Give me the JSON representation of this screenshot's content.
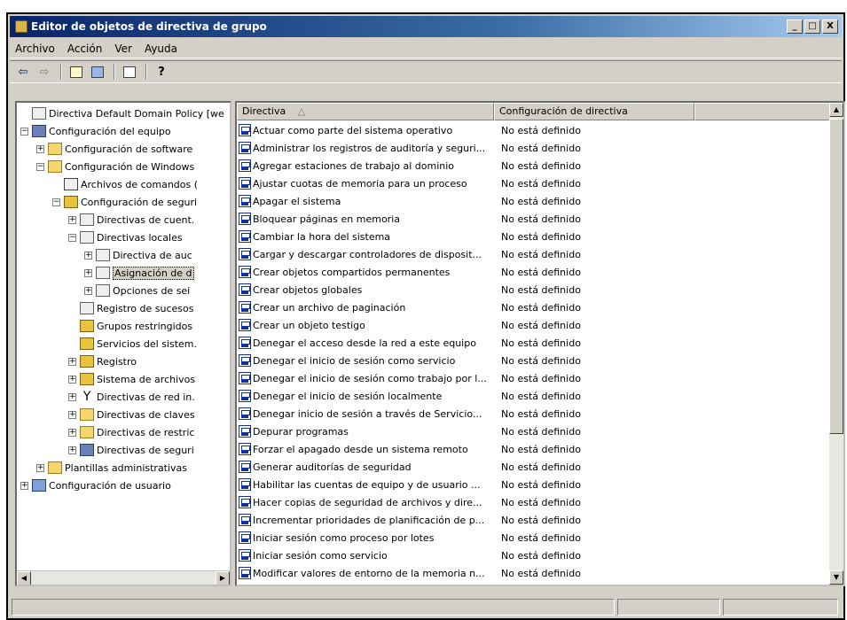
{
  "window": {
    "title": "Editor de objetos de directiva de grupo",
    "controls": [
      "_",
      "□",
      "X"
    ]
  },
  "menubar": [
    "Archivo",
    "Acción",
    "Ver",
    "Ayuda"
  ],
  "toolbar": [
    "back-arrow-icon",
    "forward-arrow-icon",
    "up-folder-icon",
    "show-hide-tree-icon",
    "export-list-icon",
    "help-icon"
  ],
  "tree": {
    "items": [
      {
        "label": "Directiva Default Domain Policy [we",
        "depth": 0,
        "expander": "",
        "icon": "policy"
      },
      {
        "label": "Configuración del equipo",
        "depth": 0,
        "expander": "−",
        "icon": "computer"
      },
      {
        "label": "Configuración de software",
        "depth": 1,
        "expander": "+",
        "icon": "folder"
      },
      {
        "label": "Configuración de Windows",
        "depth": 1,
        "expander": "−",
        "icon": "folder"
      },
      {
        "label": "Archivos de comandos (",
        "depth": 2,
        "expander": "",
        "icon": "script"
      },
      {
        "label": "Configuración de seguri",
        "depth": 2,
        "expander": "−",
        "icon": "lock"
      },
      {
        "label": "Directivas de cuent.",
        "depth": 3,
        "expander": "+",
        "icon": "policy"
      },
      {
        "label": "Directivas locales",
        "depth": 3,
        "expander": "−",
        "icon": "policy"
      },
      {
        "label": "Directiva de auc",
        "depth": 4,
        "expander": "+",
        "icon": "policy"
      },
      {
        "label": "Asignación de d",
        "depth": 4,
        "expander": "+",
        "icon": "policy",
        "selected": true
      },
      {
        "label": "Opciones de sei",
        "depth": 4,
        "expander": "+",
        "icon": "policy"
      },
      {
        "label": "Registro de sucesos",
        "depth": 3,
        "expander": "",
        "icon": "policy"
      },
      {
        "label": "Grupos restringidos",
        "depth": 3,
        "expander": "",
        "icon": "lock"
      },
      {
        "label": "Servicios del sistem.",
        "depth": 3,
        "expander": "",
        "icon": "lock"
      },
      {
        "label": "Registro",
        "depth": 3,
        "expander": "+",
        "icon": "lock"
      },
      {
        "label": "Sistema de archivos",
        "depth": 3,
        "expander": "+",
        "icon": "lock"
      },
      {
        "label": "Directivas de red in.",
        "depth": 3,
        "expander": "+",
        "icon": "net"
      },
      {
        "label": "Directivas de claves",
        "depth": 3,
        "expander": "+",
        "icon": "folder"
      },
      {
        "label": "Directivas de restric",
        "depth": 3,
        "expander": "+",
        "icon": "folder"
      },
      {
        "label": "Directivas de seguri",
        "depth": 3,
        "expander": "+",
        "icon": "computer"
      },
      {
        "label": "Plantillas administrativas",
        "depth": 1,
        "expander": "+",
        "icon": "folder"
      },
      {
        "label": "Configuración de usuario",
        "depth": 0,
        "expander": "+",
        "icon": "users"
      }
    ]
  },
  "list": {
    "columns": [
      "Directiva",
      "Configuración de directiva"
    ],
    "sort_indicator": "△",
    "rows": [
      [
        "Actuar como parte del sistema operativo",
        "No está definido"
      ],
      [
        "Administrar los registros de auditoría y seguri...",
        "No está definido"
      ],
      [
        "Agregar estaciones de trabajo al dominio",
        "No está definido"
      ],
      [
        "Ajustar cuotas de memoria para un proceso",
        "No está definido"
      ],
      [
        "Apagar el sistema",
        "No está definido"
      ],
      [
        "Bloquear páginas en memoria",
        "No está definido"
      ],
      [
        "Cambiar la hora del sistema",
        "No está definido"
      ],
      [
        "Cargar y descargar controladores de disposit...",
        "No está definido"
      ],
      [
        "Crear objetos compartidos permanentes",
        "No está definido"
      ],
      [
        "Crear objetos globales",
        "No está definido"
      ],
      [
        "Crear un archivo de paginación",
        "No está definido"
      ],
      [
        "Crear un objeto testigo",
        "No está definido"
      ],
      [
        "Denegar el acceso desde la red a este equipo",
        "No está definido"
      ],
      [
        "Denegar el inicio de sesión como servicio",
        "No está definido"
      ],
      [
        "Denegar el inicio de sesión como trabajo por l...",
        "No está definido"
      ],
      [
        "Denegar el inicio de sesión localmente",
        "No está definido"
      ],
      [
        "Denegar inicio de sesión a través de Servicio...",
        "No está definido"
      ],
      [
        "Depurar programas",
        "No está definido"
      ],
      [
        "Forzar el apagado desde un sistema remoto",
        "No está definido"
      ],
      [
        "Generar auditorías de seguridad",
        "No está definido"
      ],
      [
        "Habilitar las cuentas de equipo y de usuario ...",
        "No está definido"
      ],
      [
        "Hacer copias de seguridad de archivos y dire...",
        "No está definido"
      ],
      [
        "Incrementar prioridades de planificación de p...",
        "No está definido"
      ],
      [
        "Iniciar sesión como proceso por lotes",
        "No está definido"
      ],
      [
        "Iniciar sesión como servicio",
        "No está definido"
      ],
      [
        "Modificar valores de entorno de la memoria n...",
        "No está definido"
      ]
    ]
  }
}
